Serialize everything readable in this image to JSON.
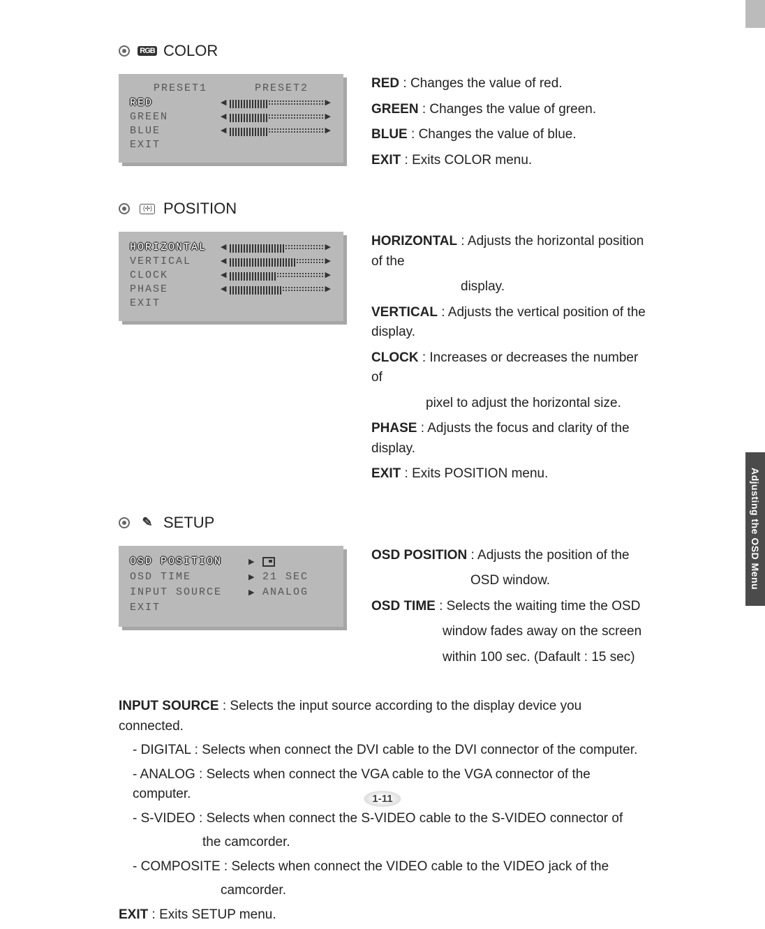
{
  "sideTab": "Adjusting the OSD Menu",
  "pageNumber": "1-11",
  "color": {
    "title": "COLOR",
    "osd": {
      "preset1": "PRESET1",
      "preset2": "PRESET2",
      "red": "RED",
      "green": "GREEN",
      "blue": "BLUE",
      "exit": "EXIT"
    },
    "desc": {
      "red_b": "RED",
      "red_t": " : Changes the value of red.",
      "green_b": "GREEN",
      "green_t": " : Changes the value of green.",
      "blue_b": "BLUE",
      "blue_t": " : Changes the value of blue.",
      "exit_b": "EXIT",
      "exit_t": " : Exits COLOR menu."
    }
  },
  "position": {
    "title": "POSITION",
    "osd": {
      "horizontal": "HORIZONTAL",
      "vertical": "VERTICAL",
      "clock": "CLOCK",
      "phase": "PHASE",
      "exit": "EXIT"
    },
    "desc": {
      "h_b": "HORIZONTAL",
      "h_t1": " : Adjusts the horizontal position of the",
      "h_t2": "display.",
      "v_b": "VERTICAL",
      "v_t": " : Adjusts the vertical position of the display.",
      "c_b": "CLOCK",
      "c_t1": " : Increases or decreases the number of",
      "c_t2": "pixel to adjust the horizontal size.",
      "p_b": "PHASE",
      "p_t": " : Adjusts the focus and clarity of the display.",
      "e_b": "EXIT",
      "e_t": " : Exits POSITION menu."
    }
  },
  "setup": {
    "title": "SETUP",
    "osd": {
      "osdpos": "OSD POSITION",
      "osdtime": "OSD TIME",
      "osdtime_val": "21 SEC",
      "input": "INPUT SOURCE",
      "input_val": "ANALOG",
      "exit": "EXIT"
    },
    "desc": {
      "op_b": "OSD POSITION",
      "op_t1": " : Adjusts the position of the",
      "op_t2": "OSD window.",
      "ot_b": "OSD TIME",
      "ot_t1": " : Selects the waiting time the OSD",
      "ot_t2": "window fades away on the screen",
      "ot_t3": "within 100 sec. (Dafault : 15 sec)"
    },
    "full": {
      "is_b": "INPUT SOURCE",
      "is_t": " : Selects the input source according to the display device you connected.",
      "digital": "- DIGITAL : Selects when connect the DVI cable to the DVI connector of the computer.",
      "analog": "- ANALOG : Selects when connect the VGA cable to the VGA connector of the computer.",
      "svideo1": "- S-VIDEO : Selects when connect the S-VIDEO cable to the S-VIDEO connector of",
      "svideo2": "the camcorder.",
      "comp1": "- COMPOSITE : Selects when connect the VIDEO cable to the VIDEO jack of the",
      "comp2": "camcorder.",
      "exit_b": "EXIT",
      "exit_t": " : Exits SETUP menu."
    }
  }
}
